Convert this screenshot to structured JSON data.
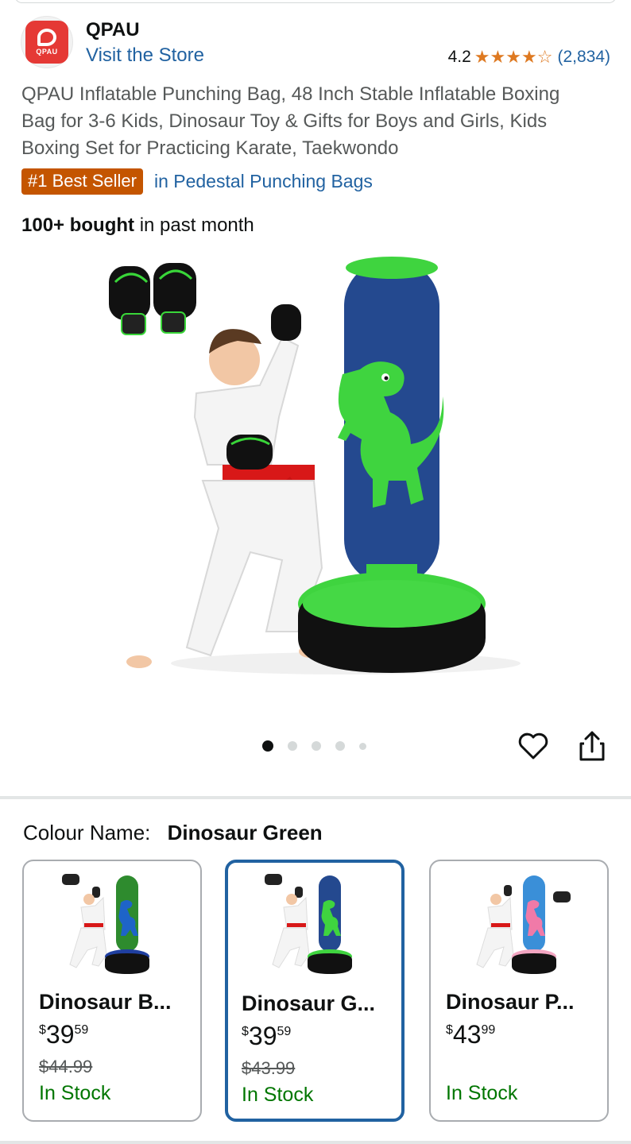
{
  "store": {
    "name": "QPAU",
    "logo_text": "QPAU",
    "visit_label": "Visit the Store",
    "rating": "4.2",
    "review_count": "(2,834)",
    "stars": 4.2
  },
  "product": {
    "title": "QPAU Inflatable Punching Bag, 48 Inch Stable Inflatable Boxing Bag for 3-6 Kids, Dinosaur Toy & Gifts for Boys and Girls, Kids Boxing Set for Practicing Karate, Taekwondo",
    "badge": "#1 Best Seller",
    "badge_category": "in Pedestal Punching Bags",
    "bought_bold": "100+ bought",
    "bought_rest": " in past month"
  },
  "gallery": {
    "image_count": 5,
    "active_index": 0
  },
  "colour": {
    "label": "Colour Name:",
    "selected": "Dinosaur Green"
  },
  "swatches": [
    {
      "name": "Dinosaur B...",
      "currency": "$",
      "whole": "39",
      "fraction": "59",
      "was": "$44.99",
      "stock": "In Stock",
      "bag_color": "#2e8b2e",
      "base_color": "#1f3fa0",
      "dino_color": "#1e64c8",
      "selected": false
    },
    {
      "name": "Dinosaur G...",
      "currency": "$",
      "whole": "39",
      "fraction": "59",
      "was": "$43.99",
      "stock": "In Stock",
      "bag_color": "#24498f",
      "base_color": "#3fd43f",
      "dino_color": "#3fd43f",
      "selected": true
    },
    {
      "name": "Dinosaur P...",
      "currency": "$",
      "whole": "43",
      "fraction": "99",
      "was": "",
      "stock": "In Stock",
      "bag_color": "#3a8fd8",
      "base_color": "#f3a6c2",
      "dino_color": "#f07aa8",
      "selected": false
    }
  ],
  "colors": {
    "link": "#2162a1",
    "badge": "#c45500",
    "star": "#de7921",
    "stock": "#007600",
    "selected_border": "#2162a1"
  }
}
